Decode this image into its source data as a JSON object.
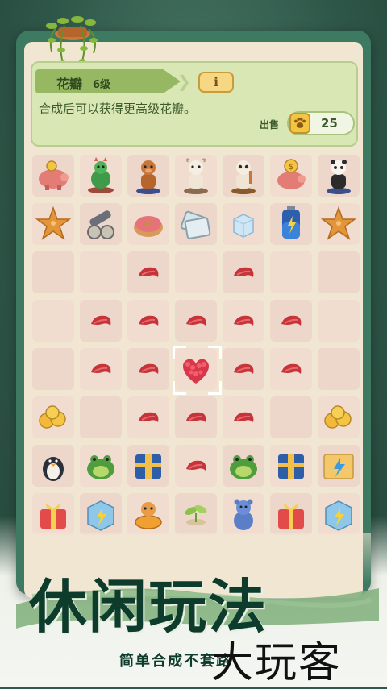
{
  "header": {
    "item_name": "花瓣",
    "level": "6级",
    "info_label": "i",
    "description": "合成后可以获得更高级花瓣。",
    "sell_label": "出售",
    "sell_price": "25"
  },
  "grid": {
    "rows": [
      [
        "piggy-bank",
        "green-dragon",
        "brown-cow-figure",
        "white-goat-figure",
        "panda-goat-figure",
        "piggy-bank-coin",
        "panda-figure"
      ],
      [
        "starfish",
        "cannon",
        "donut",
        "glass-plates",
        "ice-cube",
        "battery",
        "starfish"
      ],
      [
        "empty",
        "empty",
        "petal",
        "empty",
        "petal",
        "empty",
        "empty"
      ],
      [
        "empty",
        "petal",
        "petal",
        "petal",
        "petal",
        "petal",
        "empty"
      ],
      [
        "empty",
        "petal",
        "petal",
        "heart-bouquet",
        "petal",
        "petal",
        "empty"
      ],
      [
        "paw-coins",
        "empty",
        "petal",
        "petal",
        "petal",
        "empty",
        "paw-coins"
      ],
      [
        "penguin",
        "frog",
        "striped-box",
        "petal",
        "frog",
        "striped-box",
        "lightning-crate"
      ],
      [
        "gift-box",
        "lightning-cube",
        "dog-ring",
        "sprout",
        "blue-bear",
        "gift-box",
        "lightning-cube"
      ]
    ]
  },
  "banner": {
    "title": "休闲玩法",
    "subtitle": "简单合成不套路",
    "watermark": "大玩客"
  },
  "colors": {
    "frame_green": "#3e7a62",
    "header_green": "#d8e7b4",
    "title_dark": "#0d3b2c",
    "petal_red": "#c7333b"
  }
}
